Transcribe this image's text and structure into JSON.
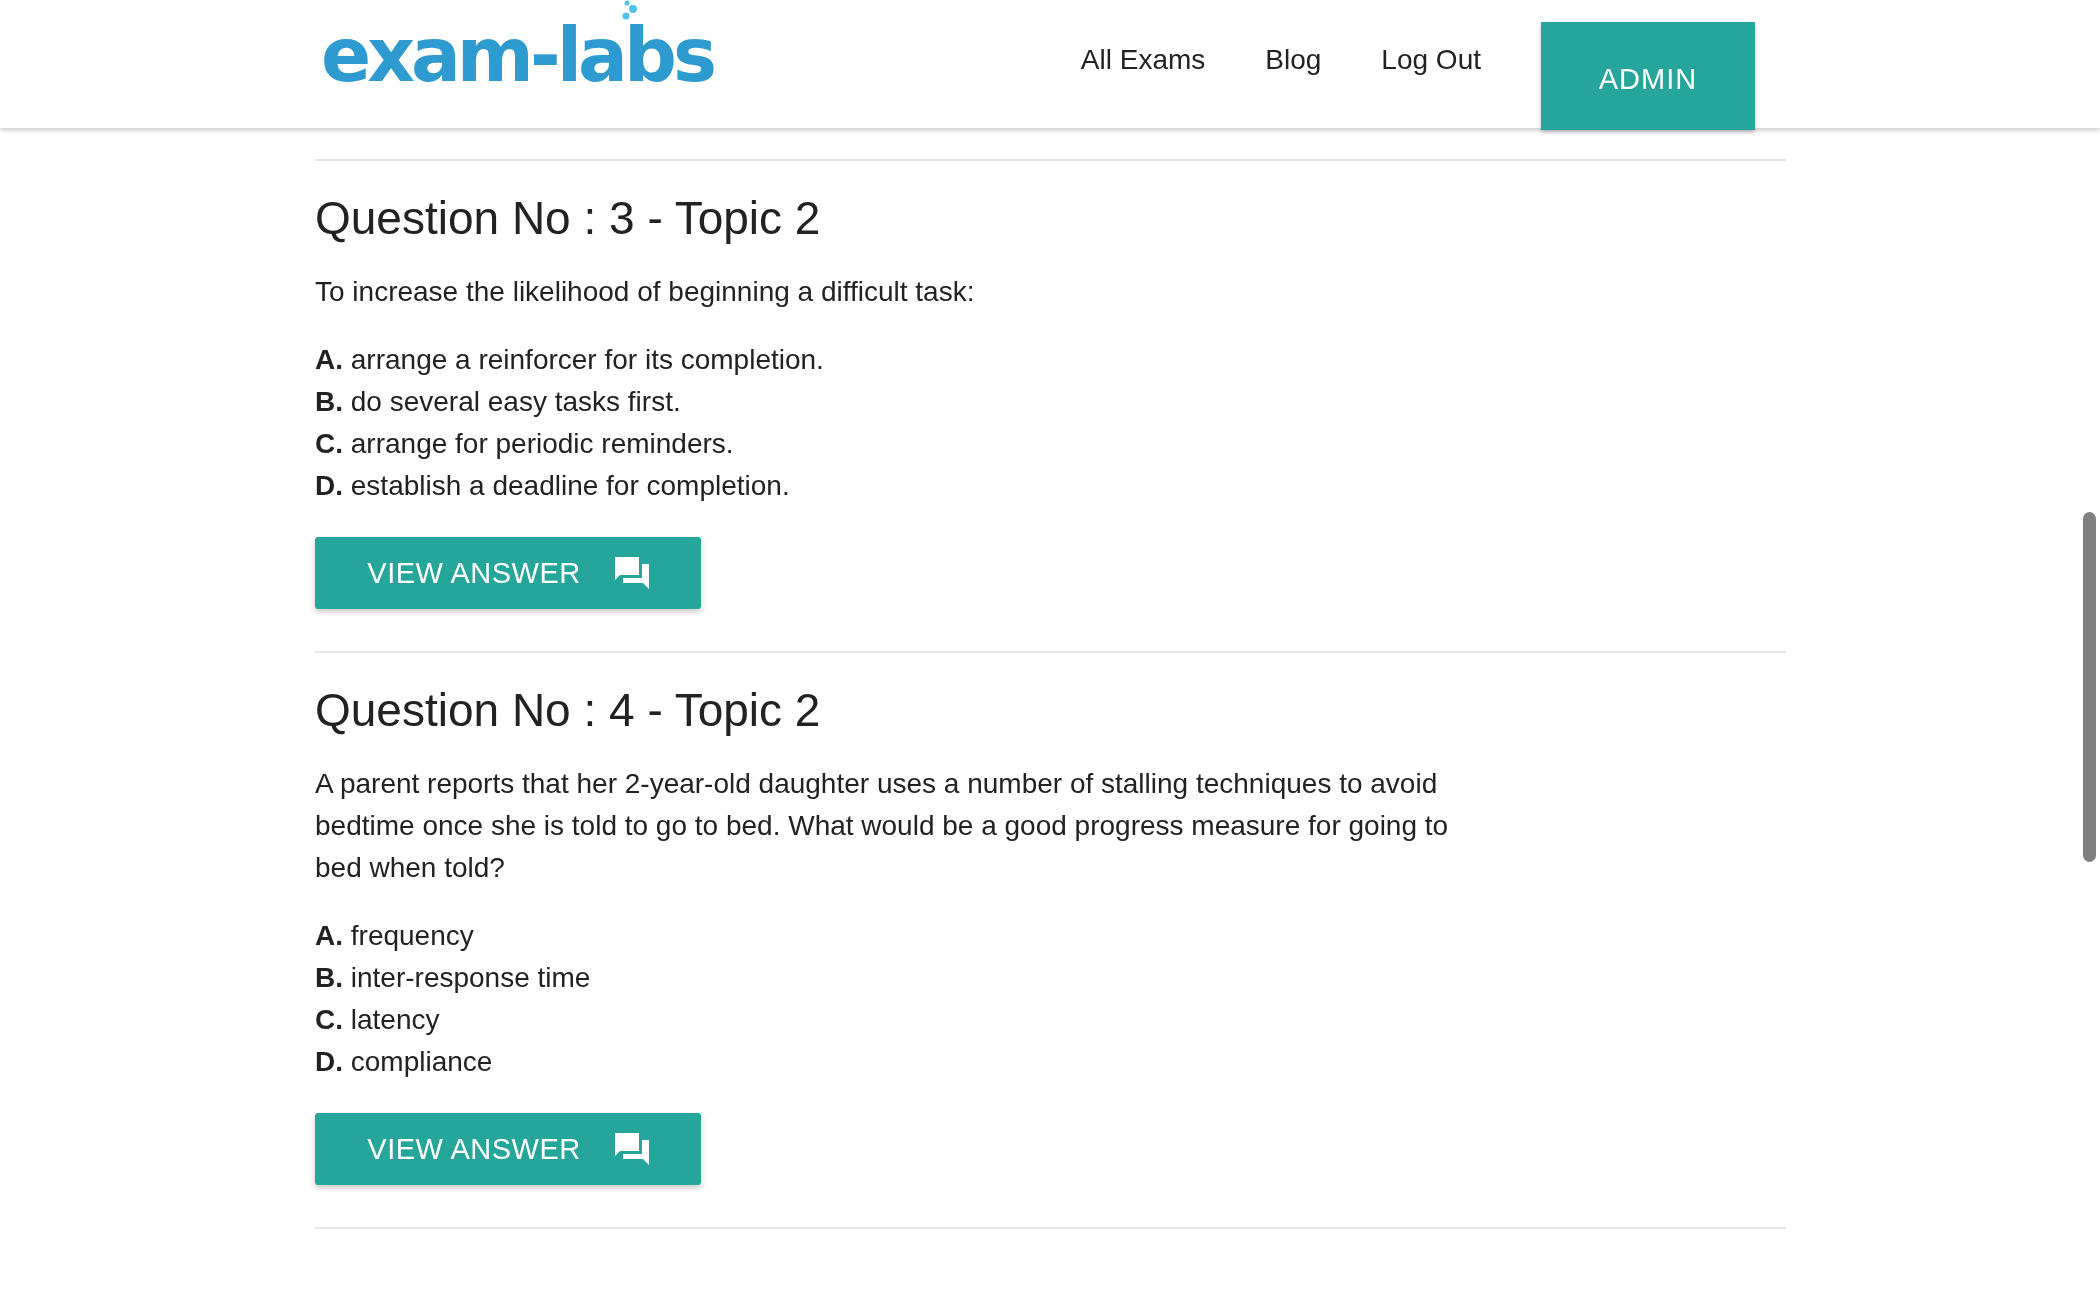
{
  "header": {
    "logo": "exam-labs",
    "nav": [
      "All Exams",
      "Blog",
      "Log Out"
    ],
    "admin_button": "ADMIN"
  },
  "questions": [
    {
      "title": "Question No : 3 - Topic 2",
      "text": "To increase the likelihood of beginning a difficult task:",
      "options": [
        {
          "letter": "A.",
          "text": "arrange a reinforcer for its completion."
        },
        {
          "letter": "B.",
          "text": "do several easy tasks first."
        },
        {
          "letter": "C.",
          "text": "arrange for periodic reminders."
        },
        {
          "letter": "D.",
          "text": "establish a deadline for completion."
        }
      ],
      "button": "VIEW ANSWER"
    },
    {
      "title": "Question No : 4 - Topic 2",
      "text": "A parent reports that her 2-year-old daughter uses a number of stalling techniques to avoid bedtime once she is told to go to bed. What would be a good progress measure for going to bed when told?",
      "options": [
        {
          "letter": "A.",
          "text": "frequency"
        },
        {
          "letter": "B.",
          "text": "inter-response time"
        },
        {
          "letter": "C.",
          "text": "latency"
        },
        {
          "letter": "D.",
          "text": "compliance"
        }
      ],
      "button": "VIEW ANSWER"
    }
  ]
}
